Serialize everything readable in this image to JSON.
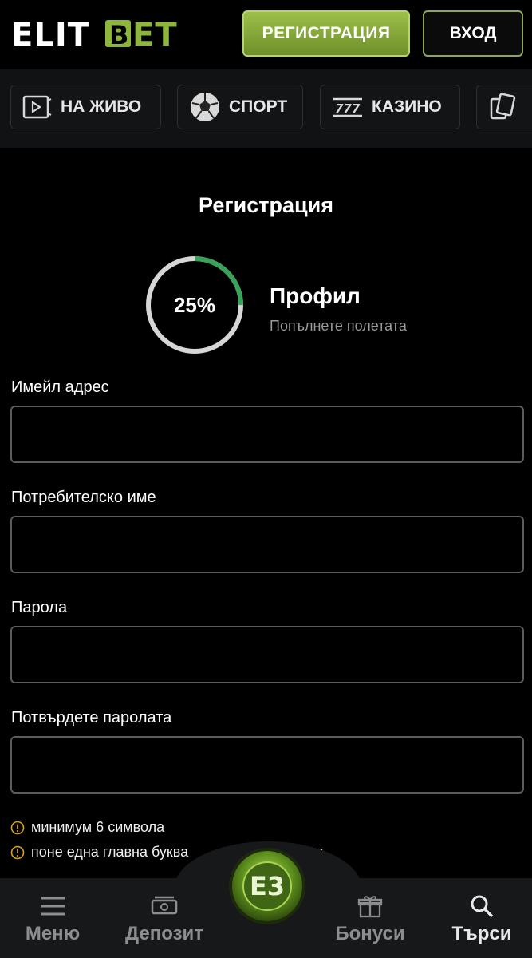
{
  "header": {
    "logo_text": "ELITBET",
    "register_label": "РЕГИСТРАЦИЯ",
    "login_label": "ВХОД"
  },
  "nav": {
    "tabs": [
      {
        "label": "НА ЖИВО",
        "icon": "live-play-icon"
      },
      {
        "label": "СПОРТ",
        "icon": "soccer-ball-icon"
      },
      {
        "label": "КАЗИНО",
        "icon": "slot-777-icon"
      },
      {
        "label": "",
        "icon": "cards-icon"
      }
    ]
  },
  "form": {
    "title": "Регистрация",
    "progress": {
      "percent_label": "25%",
      "value": 0.25
    },
    "step_title": "Профил",
    "step_subtitle": "Попълнете полетата",
    "fields": [
      {
        "label": "Имейл адрес",
        "value": "",
        "placeholder": ""
      },
      {
        "label": "Потребителско име",
        "value": "",
        "placeholder": ""
      },
      {
        "label": "Парола",
        "value": "",
        "placeholder": ""
      },
      {
        "label": "Потвърдете паролата",
        "value": "",
        "placeholder": ""
      }
    ],
    "rules": [
      "минимум 6 символа",
      "поне една главна буква",
      "а"
    ]
  },
  "bottom_nav": {
    "items": [
      {
        "label": "Меню",
        "icon": "menu-icon"
      },
      {
        "label": "Депозит",
        "icon": "deposit-icon"
      },
      {
        "label": "Бонуси",
        "icon": "gift-icon"
      },
      {
        "label": "Търси",
        "icon": "search-icon"
      }
    ],
    "center_badge_text": "E3"
  },
  "colors": {
    "accent_green": "#8fb63c",
    "progress_green": "#3aa35a",
    "background": "#000000",
    "warning": "#d9a21b"
  }
}
